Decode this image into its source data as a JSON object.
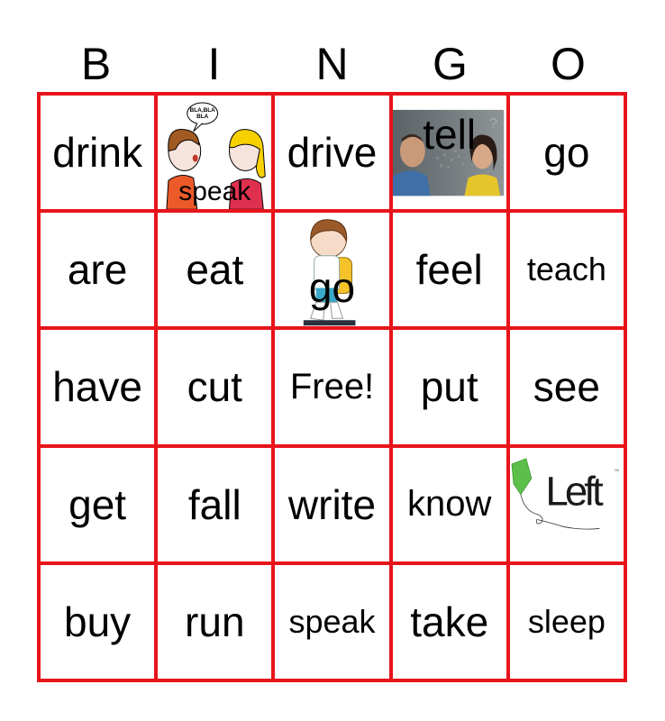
{
  "header": {
    "letters": [
      "B",
      "I",
      "N",
      "G",
      "O"
    ]
  },
  "colors": {
    "grid": "#e8141b"
  },
  "cells": [
    {
      "text": "drink",
      "image": null
    },
    {
      "text": "speak",
      "image": "two-people-talking-icon",
      "bubble": "BLA,BLA BLA"
    },
    {
      "text": "drive",
      "image": null
    },
    {
      "text": "tell",
      "image": "man-woman-photo"
    },
    {
      "text": "go",
      "image": null
    },
    {
      "text": "are",
      "image": null
    },
    {
      "text": "eat",
      "image": null
    },
    {
      "text": "go",
      "image": "boy-walking-backpack-icon"
    },
    {
      "text": "feel",
      "image": null
    },
    {
      "text": "teach",
      "image": null
    },
    {
      "text": "have",
      "image": null
    },
    {
      "text": "cut",
      "image": null
    },
    {
      "text": "Free!",
      "image": null
    },
    {
      "text": "put",
      "image": null
    },
    {
      "text": "see",
      "image": null
    },
    {
      "text": "get",
      "image": null
    },
    {
      "text": "fall",
      "image": null
    },
    {
      "text": "write",
      "image": null
    },
    {
      "text": "know",
      "image": null
    },
    {
      "text": "Left",
      "image": "kite-left-logo"
    },
    {
      "text": "buy",
      "image": null
    },
    {
      "text": "run",
      "image": null
    },
    {
      "text": "speak",
      "image": null
    },
    {
      "text": "take",
      "image": null
    },
    {
      "text": "sleep",
      "image": null
    }
  ]
}
